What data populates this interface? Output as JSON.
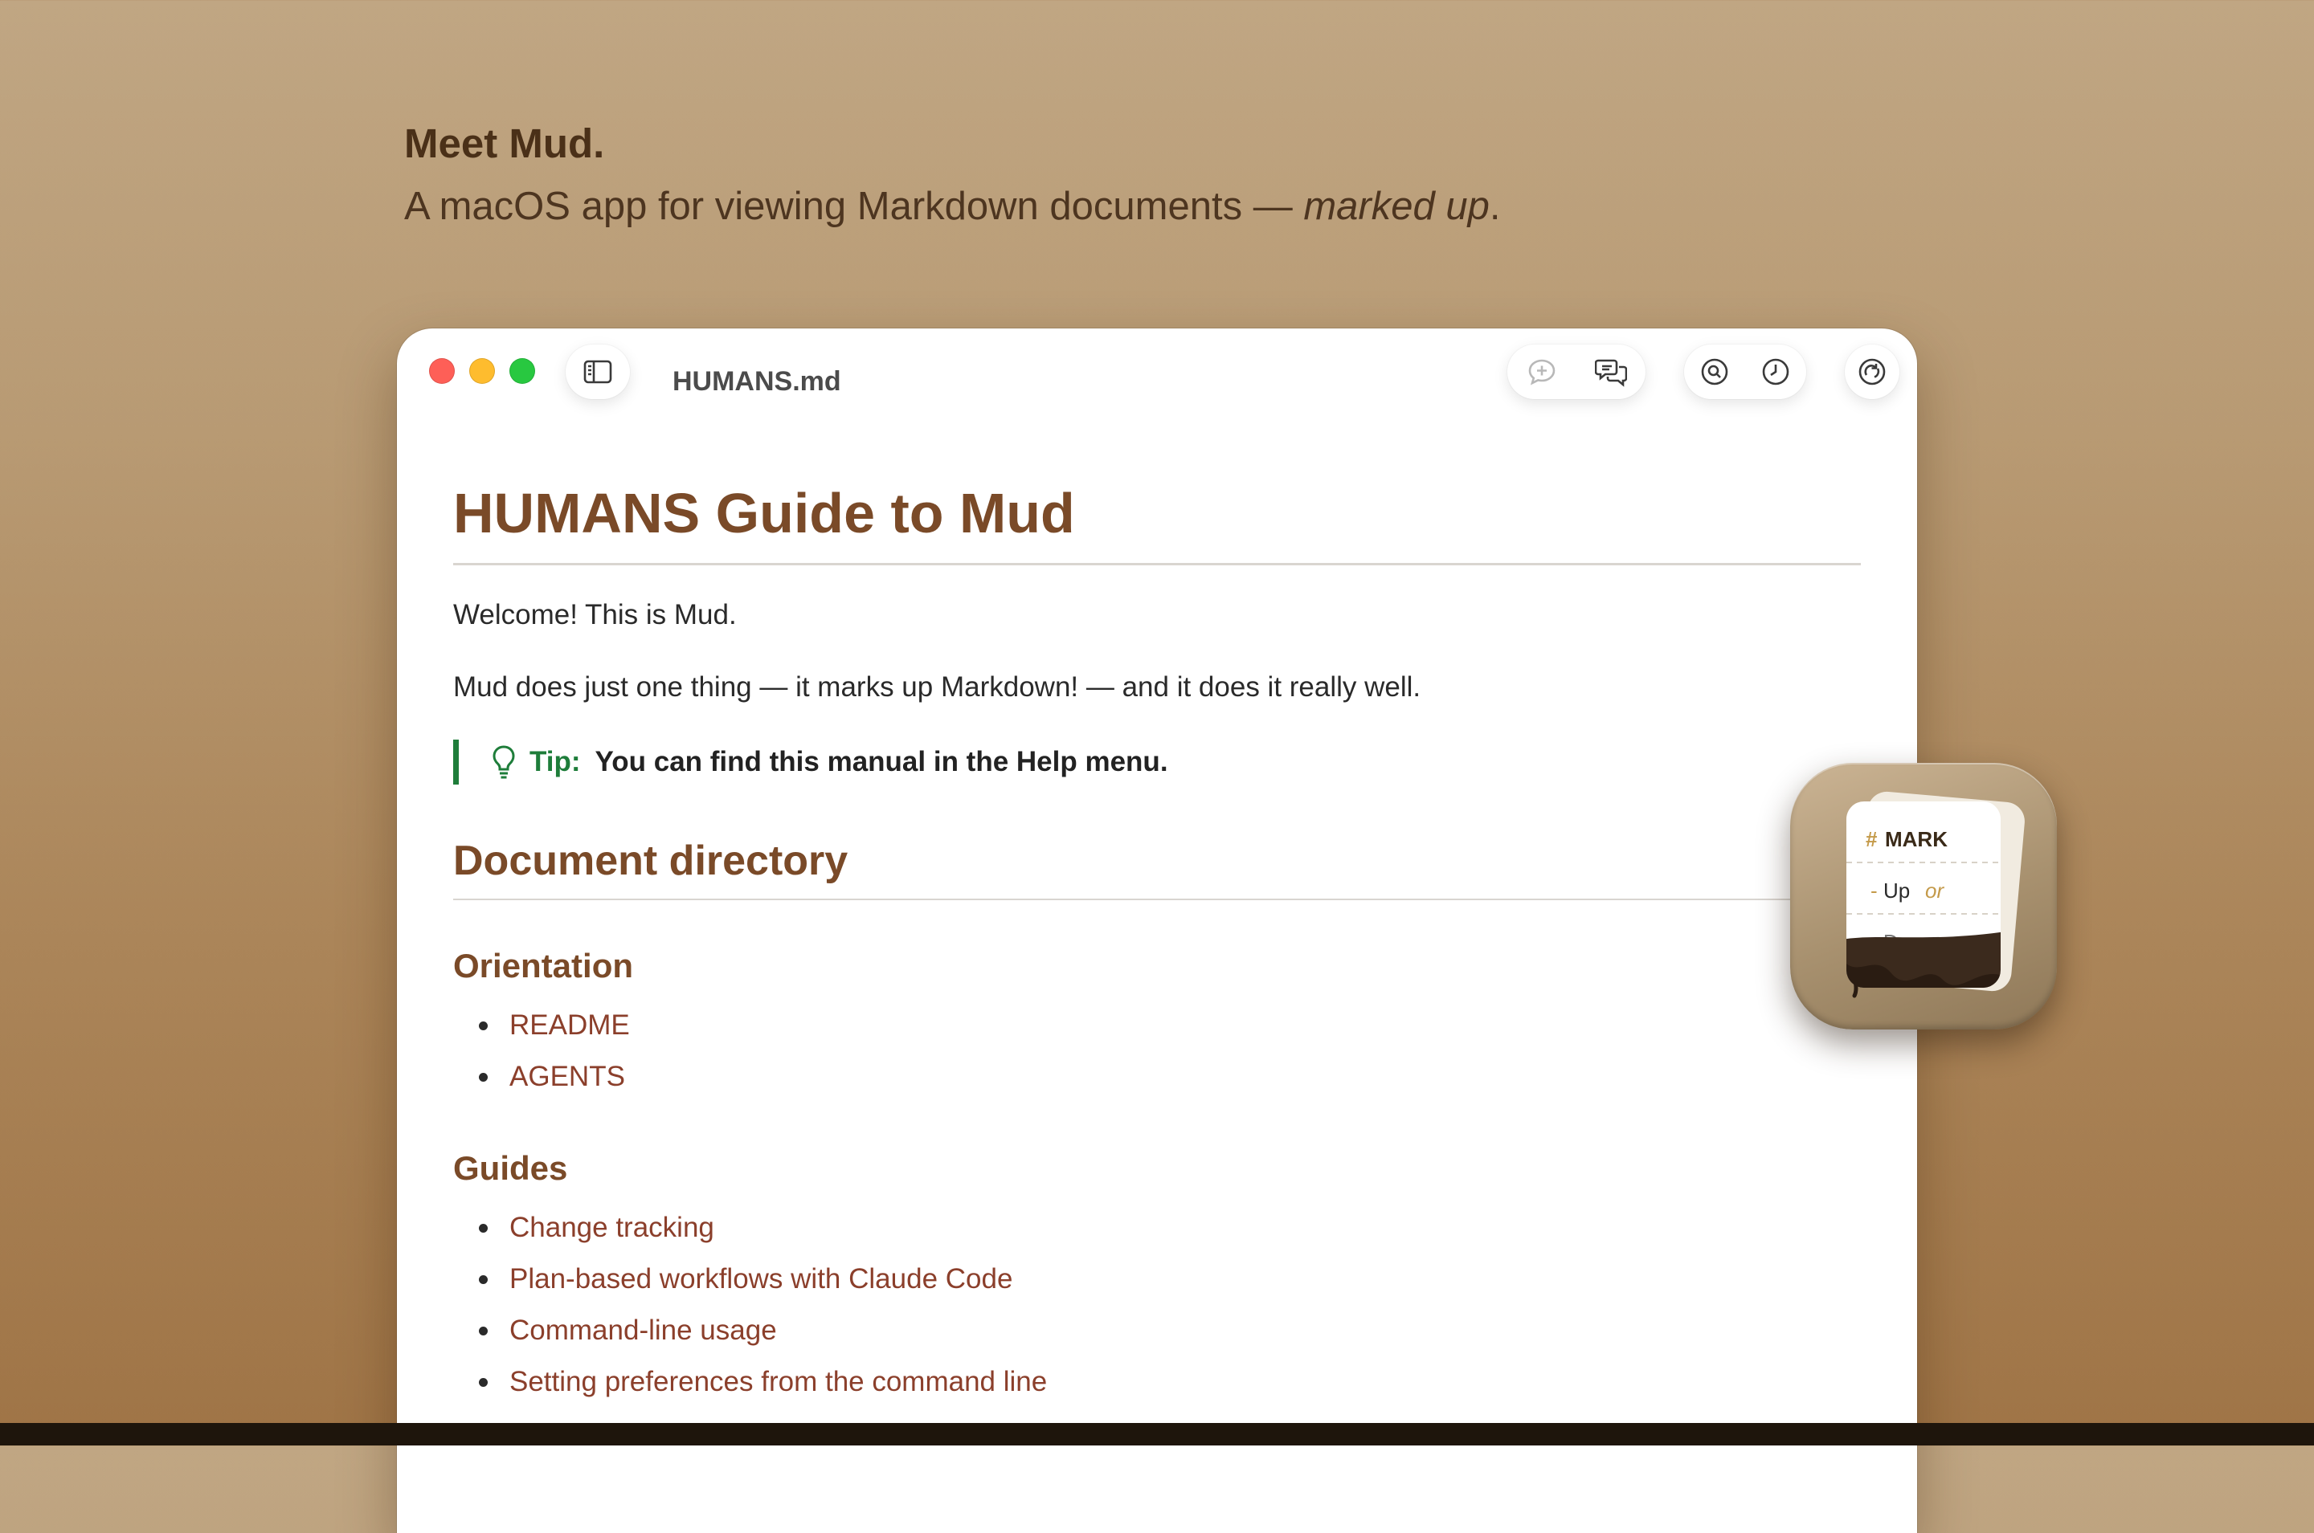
{
  "hero": {
    "title": "Meet Mud.",
    "subtitle_main": "A macOS app for viewing Markdown documents — ",
    "subtitle_em": "marked up",
    "subtitle_end": "."
  },
  "window": {
    "title": "HUMANS.md",
    "toolbar_icons": [
      "sidebar-icon",
      "add-comment-icon",
      "comments-icon",
      "find-icon",
      "history-icon",
      "sync-icon"
    ]
  },
  "document": {
    "h1": "HUMANS Guide to Mud",
    "p1": "Welcome! This is Mud.",
    "p2": "Mud does just one thing — it marks up Markdown! — and it does it really well.",
    "tip_label": "Tip:",
    "tip_text": "You can find this manual in the Help menu.",
    "h2": "Document directory",
    "sections": [
      {
        "heading": "Orientation",
        "links": [
          "README",
          "AGENTS"
        ]
      },
      {
        "heading": "Guides",
        "links": [
          "Change tracking",
          "Plan-based workflows with Claude Code",
          "Command-line usage",
          "Setting preferences from the command line"
        ]
      }
    ]
  },
  "app_icon": {
    "line1_hash": "#",
    "line1_word": "MARK",
    "line2_dash": "-",
    "line2_word": "Up",
    "line2_or": "or",
    "line3": "- Down"
  },
  "colors": {
    "heading": "#7a4a28",
    "link": "#8b3f2b",
    "tip": "#1e7d3a",
    "close": "#fe5f57",
    "minimize": "#febc2e",
    "maximize": "#28c840"
  }
}
